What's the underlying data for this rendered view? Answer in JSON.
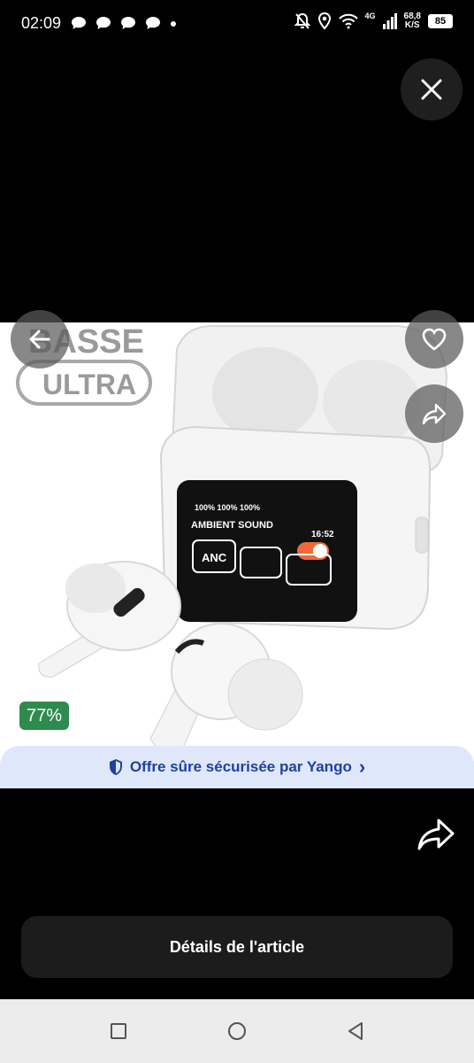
{
  "status_bar": {
    "time": "02:09",
    "network_type": "4G",
    "net_speed_value": "68,8",
    "net_speed_unit": "K/S",
    "battery": "85"
  },
  "product_image": {
    "badge_line1": "BASSE",
    "badge_line2": "ULTRA",
    "screen_status": "100%   100%   100%",
    "screen_mode": "AMBIENT SOUND",
    "screen_time": "16:52",
    "screen_button_anc": "ANC",
    "discount": "77%"
  },
  "banner": {
    "text": "Offre sûre sécurisée par Yango",
    "chevron": "›"
  },
  "actions": {
    "details_label": "Détails de l'article"
  },
  "icons": {
    "close": "close-icon",
    "back": "arrow-left-icon",
    "favorite": "heart-icon",
    "share": "share-icon"
  }
}
